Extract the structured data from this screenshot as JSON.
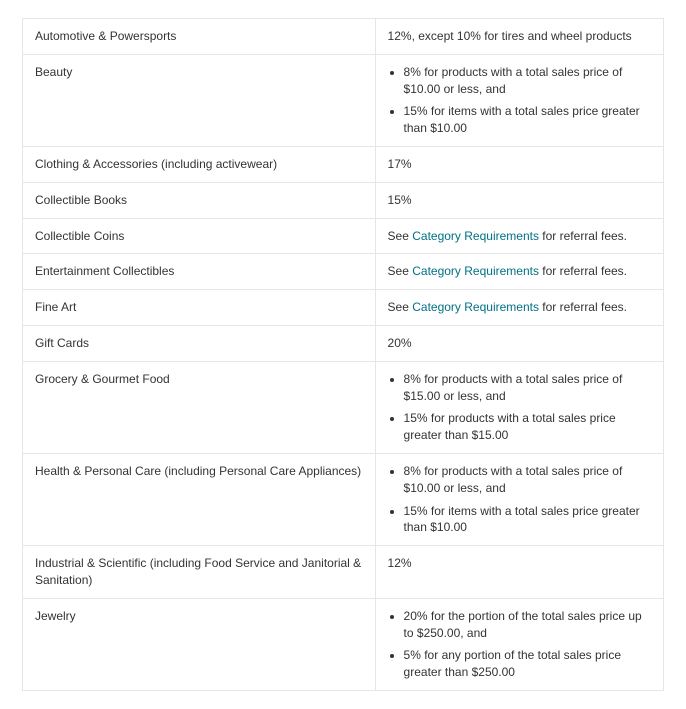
{
  "link_text": "Category Requirements",
  "rows": [
    {
      "category": "Automotive & Powersports",
      "type": "text",
      "fee": "12%, except 10% for tires and wheel products"
    },
    {
      "category": "Beauty",
      "type": "list",
      "fee": [
        "8% for products with a total sales price of $10.00 or less, and",
        "15% for items with a total sales price greater than $10.00"
      ]
    },
    {
      "category": "Clothing & Accessories (including activewear)",
      "type": "text",
      "fee": "17%"
    },
    {
      "category": "Collectible Books",
      "type": "text",
      "fee": "15%"
    },
    {
      "category": "Collectible Coins",
      "type": "link",
      "fee_prefix": "See ",
      "fee_suffix": " for referral fees."
    },
    {
      "category": "Entertainment Collectibles",
      "type": "link",
      "fee_prefix": "See ",
      "fee_suffix": " for referral fees."
    },
    {
      "category": "Fine Art",
      "type": "link",
      "fee_prefix": "See ",
      "fee_suffix": " for referral fees."
    },
    {
      "category": "Gift Cards",
      "type": "text",
      "fee": "20%"
    },
    {
      "category": "Grocery & Gourmet Food",
      "type": "list",
      "fee": [
        "8% for products with a total sales price of $15.00 or less, and",
        "15% for products with a total sales price greater than $15.00"
      ]
    },
    {
      "category": "Health & Personal Care (including Personal Care Appliances)",
      "type": "list",
      "fee": [
        "8% for products with a total sales price of $10.00 or less, and",
        "15% for items with a total sales price greater than $10.00"
      ]
    },
    {
      "category": "Industrial & Scientific (including Food Service and Janitorial & Sanitation)",
      "type": "text",
      "fee": "12%"
    },
    {
      "category": "Jewelry",
      "type": "list",
      "fee": [
        "20% for the portion of the total sales price up to $250.00, and",
        "5% for any portion of the total sales price greater than $250.00"
      ]
    }
  ]
}
